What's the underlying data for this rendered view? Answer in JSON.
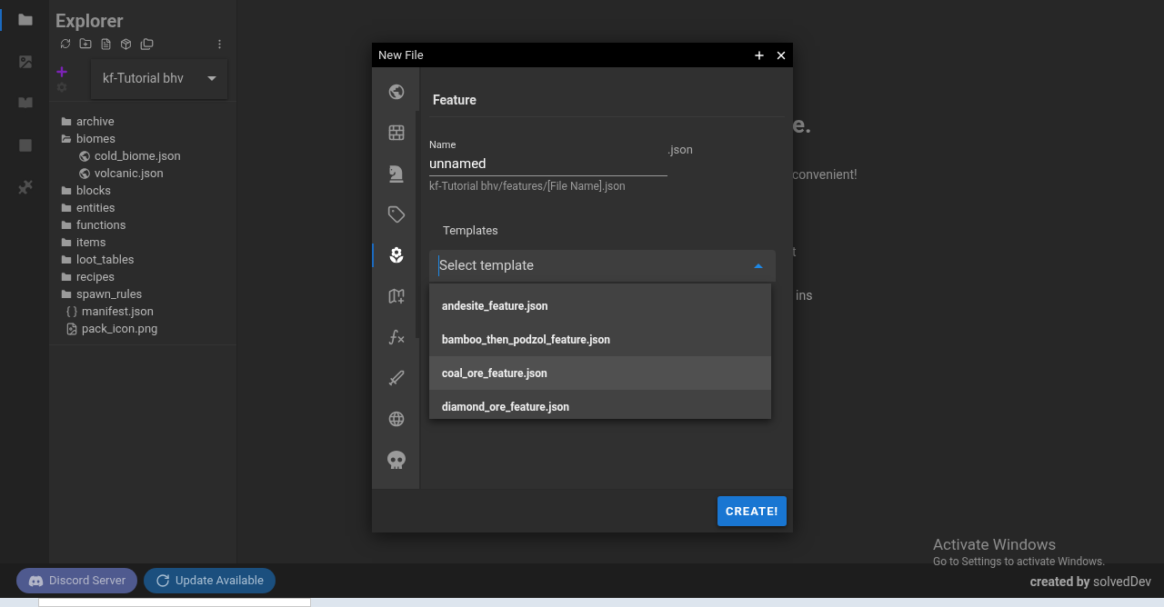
{
  "activity_bar": [
    {
      "selected": true
    },
    {
      "selected": false
    },
    {
      "selected": false
    },
    {
      "selected": false
    },
    {
      "selected": false
    }
  ],
  "explorer": {
    "title": "Explorer",
    "project": {
      "name": "kf-Tutorial bhv"
    },
    "tree": [
      {
        "kind": "folder",
        "label": "archive"
      },
      {
        "kind": "folder",
        "label": "biomes",
        "expanded": true,
        "children": [
          {
            "kind": "globe",
            "label": "cold_biome.json"
          },
          {
            "kind": "globe",
            "label": "volcanic.json"
          }
        ]
      },
      {
        "kind": "folder",
        "label": "blocks"
      },
      {
        "kind": "folder",
        "label": "entities"
      },
      {
        "kind": "folder",
        "label": "functions"
      },
      {
        "kind": "folder",
        "label": "items"
      },
      {
        "kind": "folder",
        "label": "loot_tables"
      },
      {
        "kind": "folder",
        "label": "recipes"
      },
      {
        "kind": "folder",
        "label": "spawn_rules"
      },
      {
        "kind": "json",
        "label": "manifest.json"
      },
      {
        "kind": "image",
        "label": "pack_icon.png"
      }
    ]
  },
  "background": {
    "heading": "e.",
    "lines": [
      "convenient!",
      "t",
      "ins"
    ]
  },
  "dialog": {
    "title": "New File",
    "sidebar": [
      {
        "selected": false
      },
      {
        "selected": false
      },
      {
        "selected": false
      },
      {
        "selected": false
      },
      {
        "selected": true
      },
      {
        "selected": false
      },
      {
        "selected": false
      },
      {
        "selected": false
      },
      {
        "selected": false
      },
      {
        "selected": false
      }
    ],
    "section": "Feature",
    "name_field": {
      "label": "Name",
      "value": "unnamed",
      "suffix": ".json",
      "hint": "kf-Tutorial bhv/features/[File Name].json"
    },
    "templates": {
      "label": "Templates",
      "placeholder": "Select template",
      "open": true,
      "options": [
        {
          "label": "andesite_feature.json",
          "highlighted": false
        },
        {
          "label": "bamboo_then_podzol_feature.json",
          "highlighted": false
        },
        {
          "label": "coal_ore_feature.json",
          "highlighted": true
        },
        {
          "label": "diamond_ore_feature.json",
          "highlighted": false
        }
      ]
    },
    "create_button": "CREATE!"
  },
  "status_bar": {
    "buttons": [
      {
        "kind": "discord",
        "label": "Discord Server"
      },
      {
        "kind": "update",
        "label": "Update Available"
      }
    ],
    "credit": "**created by** solvedDev"
  },
  "activation": {
    "title": "Activate Windows",
    "text": "Go to Settings to activate Windows."
  }
}
